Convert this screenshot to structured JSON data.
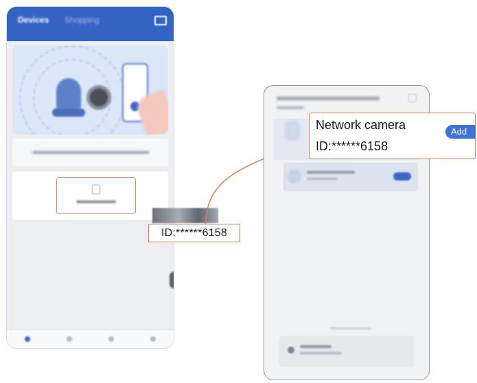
{
  "left_app": {
    "tabs": [
      "Devices",
      "Shopping"
    ],
    "nav_items": [
      "home",
      "cloud",
      "messages",
      "profile"
    ]
  },
  "scan_result": {
    "id_label": "ID:******6158"
  },
  "callout": {
    "device_name": "Network camera",
    "device_id": "ID:******6158",
    "add_label": "Add"
  },
  "colors": {
    "header_blue": "#3563c4",
    "accent_orange": "#e07b52",
    "add_button_blue": "#3f72d4"
  }
}
